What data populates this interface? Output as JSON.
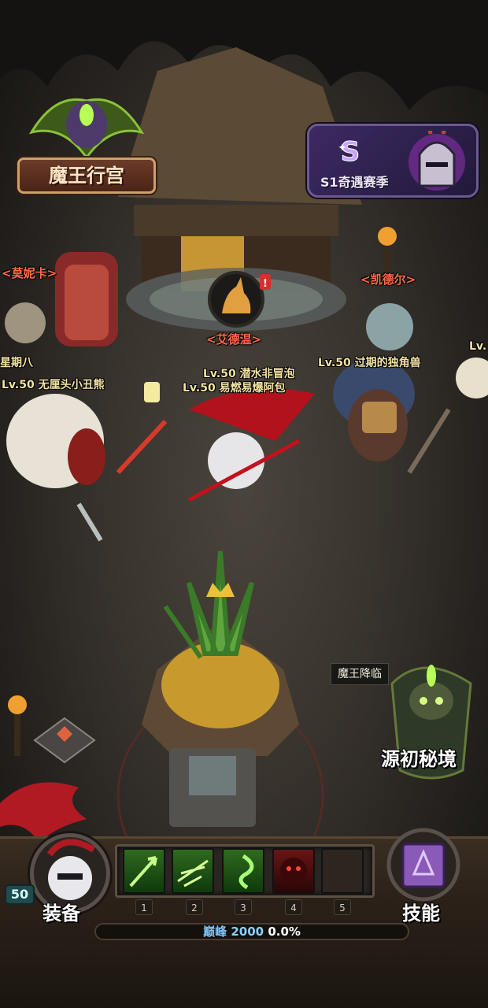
{
  "location": {
    "title": "魔王行宫"
  },
  "season": {
    "label": "S1奇遇赛季",
    "badge": "S"
  },
  "npcs": [
    {
      "name": "<莫妮卡>"
    },
    {
      "name": "<艾德温>"
    },
    {
      "name": "<凯德尔>"
    }
  ],
  "players": [
    {
      "label": "星期八"
    },
    {
      "label": "Lv.50 无厘头小丑熊"
    },
    {
      "label": "Lv.50 潜水非冒泡"
    },
    {
      "label": "Lv.50 易燃易爆阿包"
    },
    {
      "label": "Lv.50 过期的独角兽"
    },
    {
      "label": "Lv."
    }
  ],
  "dungeon": {
    "badge": "魔王降临",
    "label": "源初秘境"
  },
  "hud": {
    "level": "50",
    "equip_label": "装备",
    "skill_label": "技能",
    "slot_numbers": [
      "1",
      "2",
      "3",
      "4",
      "5"
    ],
    "peak": {
      "name": "巅峰",
      "value": "2000",
      "percent": "0.0%"
    }
  },
  "colors": {
    "npc_name": "#ff6b4a",
    "player_name": "#f3e3a3",
    "peak_text": "#7fc6ff",
    "season_bg": "#3c2a63"
  },
  "icons": [
    "palace-emblem-icon",
    "season-helmet-icon",
    "dog-npc-portrait-icon",
    "red-alert-icon",
    "pineapple-boss-icon",
    "dungeon-demon-icon",
    "diamond-waypoint-icon",
    "spellbook-icon",
    "knight-avatar-icon"
  ]
}
